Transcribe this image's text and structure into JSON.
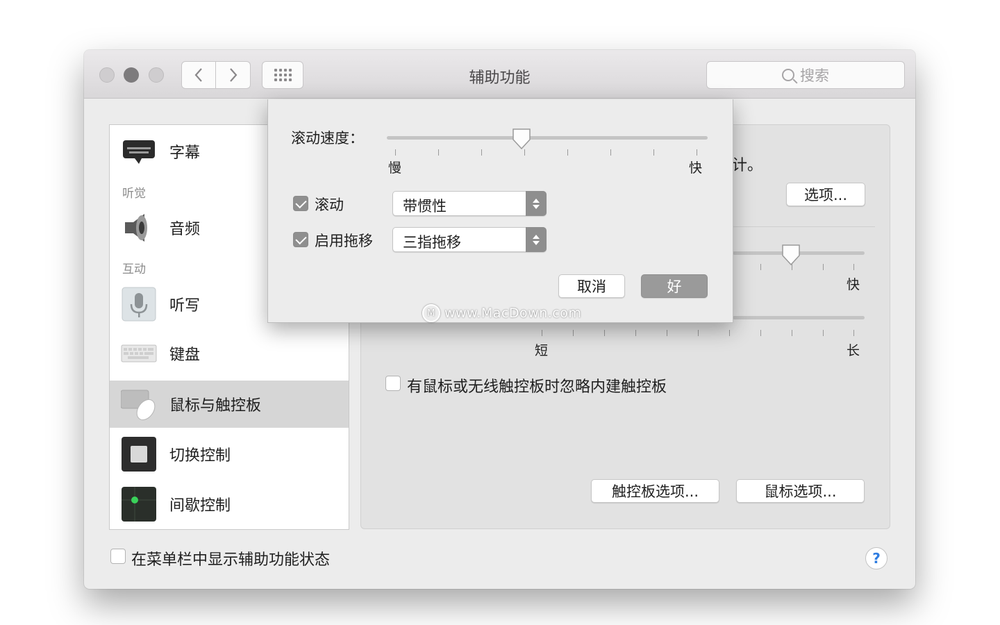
{
  "window": {
    "title": "辅助功能"
  },
  "search": {
    "placeholder": "搜索"
  },
  "sidebar": {
    "items": [
      {
        "label": "字幕",
        "icon": "captions-icon"
      },
      {
        "label": "音频",
        "icon": "speaker-icon"
      },
      {
        "label": "听写",
        "icon": "microphone-icon"
      },
      {
        "label": "键盘",
        "icon": "keyboard-icon"
      },
      {
        "label": "鼠标与触控板",
        "icon": "mouse-trackpad-icon",
        "selected": true
      },
      {
        "label": "切换控制",
        "icon": "switch-control-icon"
      },
      {
        "label": "间歇控制",
        "icon": "dwell-control-icon"
      }
    ],
    "sections": {
      "hearing": "听觉",
      "interaction": "互动"
    }
  },
  "main": {
    "partial_text": "计。",
    "options_button": "选项...",
    "slider1_fast_label": "快",
    "slider2_short_label": "短",
    "slider2_long_label": "长",
    "ignore_builtin_checkbox": "有鼠标或无线触控板时忽略内建触控板",
    "trackpad_options_button": "触控板选项...",
    "mouse_options_button": "鼠标选项..."
  },
  "footer": {
    "show_status_checkbox": "在菜单栏中显示辅助功能状态",
    "help": "?"
  },
  "sheet": {
    "scroll_speed_label": "滚动速度：",
    "slow_label": "慢",
    "fast_label": "快",
    "scroll_speed_value": 0.42,
    "scrolling": {
      "label": "滚动",
      "checked": true,
      "value": "带惯性"
    },
    "dragging": {
      "label": "启用拖移",
      "checked": true,
      "value": "三指拖移"
    },
    "cancel_button": "取消",
    "ok_button": "好"
  },
  "watermark": "www.MacDown.com",
  "colors": {
    "ok_button": "#9a9a9a",
    "help_accent": "#2f7de1",
    "selected_row": "#d6d6d6"
  }
}
